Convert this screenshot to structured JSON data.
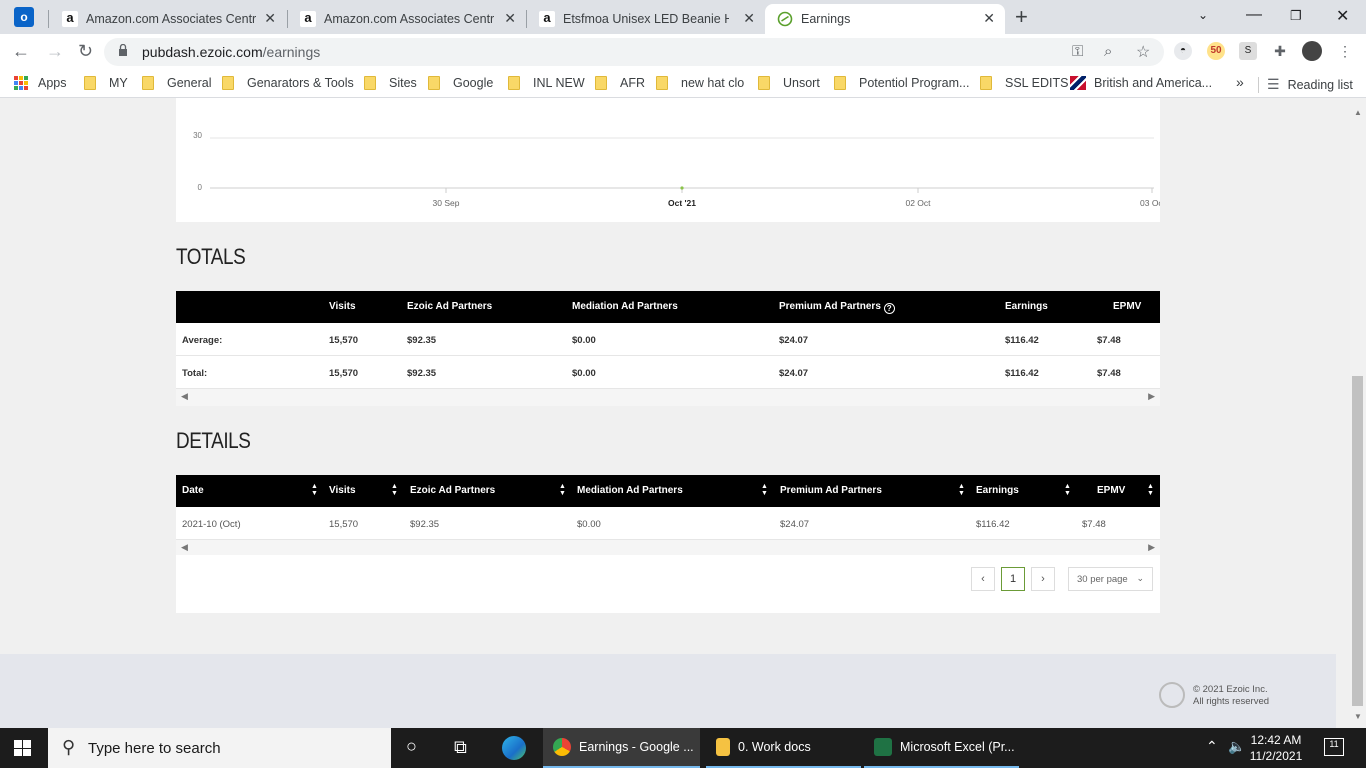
{
  "browser": {
    "tabs": [
      {
        "title": "Amazon.com Associates Central",
        "icon": "amazon-icon"
      },
      {
        "title": "Amazon.com Associates Central",
        "icon": "amazon-icon"
      },
      {
        "title": "Etsfmoa Unisex LED Beanie Hat w",
        "icon": "amazon-icon"
      },
      {
        "title": "Earnings",
        "icon": "ezoic-icon",
        "active": true
      }
    ],
    "url_host": "pubdash.ezoic.com",
    "url_path": "/earnings",
    "bookmarks": [
      "Apps",
      "MY",
      "General",
      "Genarators & Tools",
      "Sites",
      "Google",
      "INL NEW",
      "AFR",
      "new hat clo",
      "Unsort",
      "Potentiol Program...",
      "SSL EDITS",
      "British and America..."
    ],
    "reading_list": "Reading list",
    "more_bookmarks": "»"
  },
  "chart": {
    "y_ticks": [
      "30",
      "0"
    ],
    "x_ticks": [
      "30 Sep",
      "Oct '21",
      "02 Oct",
      "03 Oc"
    ]
  },
  "totals": {
    "title": "TOTALS",
    "headers": [
      "Visits",
      "Ezoic Ad Partners",
      "Mediation Ad Partners",
      "Premium Ad Partners",
      "Earnings",
      "EPMV"
    ],
    "rows": [
      {
        "label": "Average:",
        "visits": "15,570",
        "ezoic": "$92.35",
        "mediation": "$0.00",
        "premium": "$24.07",
        "earnings": "$116.42",
        "epmv": "$7.48"
      },
      {
        "label": "Total:",
        "visits": "15,570",
        "ezoic": "$92.35",
        "mediation": "$0.00",
        "premium": "$24.07",
        "earnings": "$116.42",
        "epmv": "$7.48"
      }
    ]
  },
  "details": {
    "title": "DETAILS",
    "headers": [
      "Date",
      "Visits",
      "Ezoic Ad Partners",
      "Mediation Ad Partners",
      "Premium Ad Partners",
      "Earnings",
      "EPMV"
    ],
    "rows": [
      {
        "date": "2021-10 (Oct)",
        "visits": "15,570",
        "ezoic": "$92.35",
        "mediation": "$0.00",
        "premium": "$24.07",
        "earnings": "$116.42",
        "epmv": "$7.48"
      }
    ]
  },
  "pager": {
    "prev": "‹",
    "page": "1",
    "next": "›",
    "per_page": "30 per page"
  },
  "footer": {
    "line1": "© 2021 Ezoic Inc.",
    "line2": "All rights reserved"
  },
  "taskbar": {
    "search_placeholder": "Type here to search",
    "apps": [
      {
        "label": "Earnings - Google ...",
        "active": true
      },
      {
        "label": "0. Work docs"
      },
      {
        "label": "Microsoft Excel (Pr..."
      }
    ],
    "time": "12:42 AM",
    "date": "11/2/2021",
    "notifications": "11"
  },
  "colors": {
    "header_bg": "#000000",
    "page_bg": "#f0f0f0",
    "active_page": "#6b9b37"
  }
}
